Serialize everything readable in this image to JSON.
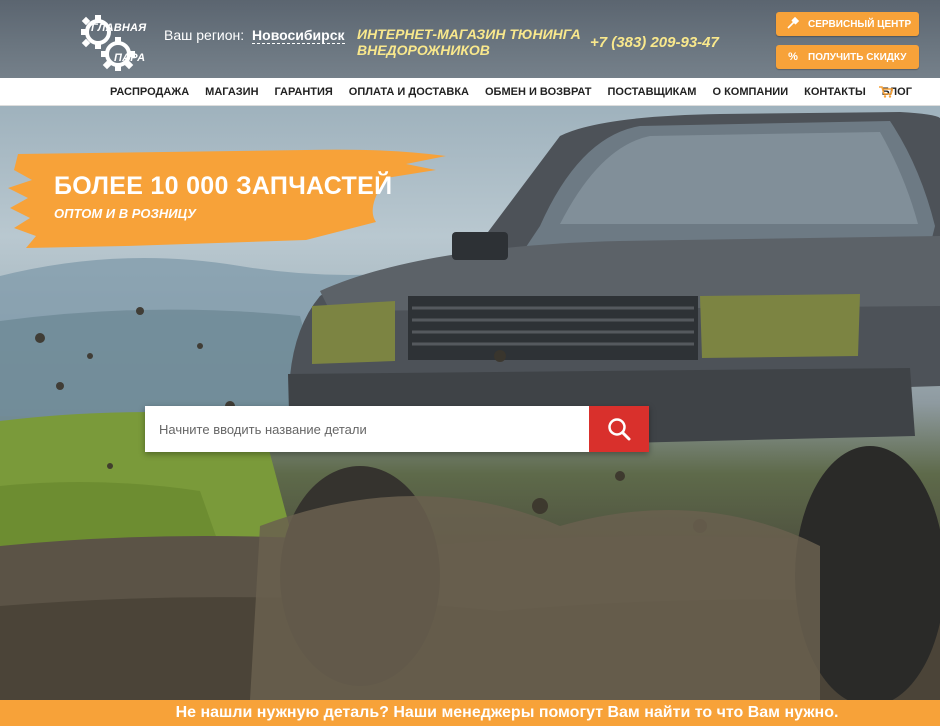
{
  "header": {
    "logo": {
      "line1": "ГЛАВНАЯ",
      "line2": "ПАРА"
    },
    "region_label": "Ваш регион:",
    "region_city": "Новосибирск",
    "tagline": "ИНТЕРНЕТ-МАГАЗИН ТЮНИНГА ВНЕДОРОЖНИКОВ",
    "phone": "+7 (383) 209-93-47",
    "service_button": {
      "label": "СЕРВИСНЫЙ ЦЕНТР",
      "icon": "tools-icon"
    },
    "discount_button": {
      "label": "ПОЛУЧИТЬ СКИДКУ",
      "icon": "percent-icon"
    }
  },
  "nav": {
    "items": [
      {
        "label": "РАСПРОДАЖА"
      },
      {
        "label": "МАГАЗИН"
      },
      {
        "label": "ГАРАНТИЯ"
      },
      {
        "label": "ОПЛАТА И ДОСТАВКА"
      },
      {
        "label": "ОБМЕН И ВОЗВРАТ"
      },
      {
        "label": "ПОСТАВЩИКАМ"
      },
      {
        "label": "О КОМПАНИИ"
      },
      {
        "label": "КОНТАКТЫ"
      },
      {
        "label": "БЛОГ"
      }
    ],
    "cart_icon": "cart-icon"
  },
  "hero": {
    "promo_title": "БОЛЕЕ 10 000 ЗАПЧАСТЕЙ",
    "promo_subtitle": "ОПТОМ И В РОЗНИЦУ",
    "search": {
      "placeholder": "Начните вводить название детали",
      "value": "",
      "icon": "search-icon"
    }
  },
  "banner": {
    "text": "Не нашли нужную деталь? Наши менеджеры помогут Вам найти то что Вам нужно."
  },
  "colors": {
    "accent": "#f7a239",
    "search_button": "#d9302c",
    "tagline": "#f9e88c"
  }
}
